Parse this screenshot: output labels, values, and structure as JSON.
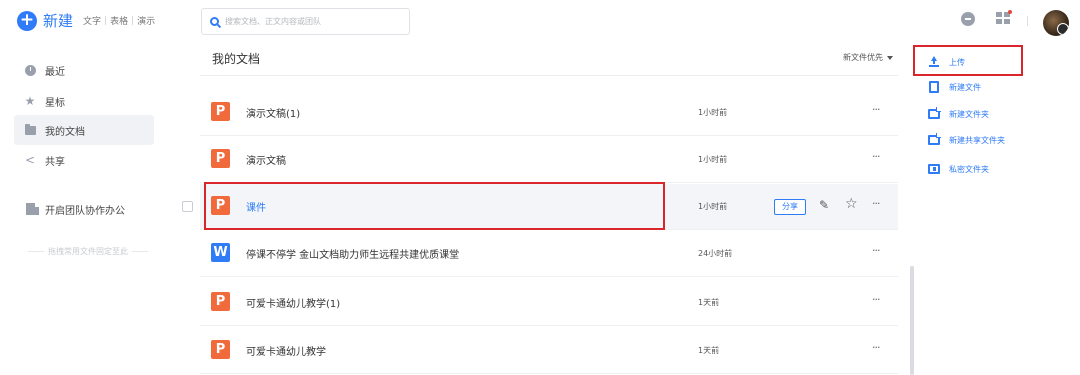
{
  "sidebar": {
    "new_label": "新建",
    "new_types": [
      "文字",
      "表格",
      "演示"
    ],
    "nav": [
      {
        "label": "最近",
        "icon": "clock-icon"
      },
      {
        "label": "星标",
        "icon": "star-icon"
      },
      {
        "label": "我的文档",
        "icon": "folder-icon",
        "active": true
      },
      {
        "label": "共享",
        "icon": "share-icon"
      }
    ],
    "team_label": "开启团队协作办公",
    "pin_hint": "拖拽常用文件固定至此"
  },
  "search": {
    "placeholder": "搜索文档、正文内容或团队"
  },
  "main": {
    "title": "我的文档",
    "sort_label": "新文件优先",
    "files": [
      {
        "name": "演示文稿(1)",
        "time": "1小时前",
        "type": "ppt",
        "icon_glyph": "P"
      },
      {
        "name": "演示文稿",
        "time": "1小时前",
        "type": "ppt",
        "icon_glyph": "P"
      },
      {
        "name": "课件",
        "time": "1小时前",
        "type": "ppt",
        "icon_glyph": "P",
        "highlighted": true
      },
      {
        "name": "停课不停学 金山文档助力师生远程共建优质课堂",
        "time": "24小时前",
        "type": "doc",
        "icon_glyph": "W"
      },
      {
        "name": "可爱卡通幼儿教学(1)",
        "time": "1天前",
        "type": "ppt",
        "icon_glyph": "P"
      },
      {
        "name": "可爱卡通幼儿教学",
        "time": "1天前",
        "type": "ppt",
        "icon_glyph": "P"
      }
    ],
    "share_label": "分享",
    "more_glyph": "···"
  },
  "actions": [
    {
      "label": "上传",
      "icon": "upload-icon"
    },
    {
      "label": "新建文件",
      "icon": "new-file-icon"
    },
    {
      "label": "新建文件夹",
      "icon": "new-folder-icon"
    },
    {
      "label": "新建共享文件夹",
      "icon": "new-shared-folder-icon"
    },
    {
      "label": "私密文件夹",
      "icon": "private-folder-icon"
    }
  ],
  "colors": {
    "accent": "#2f7cf6",
    "ppt": "#f06a3c",
    "highlight_box": "#d9262b"
  }
}
